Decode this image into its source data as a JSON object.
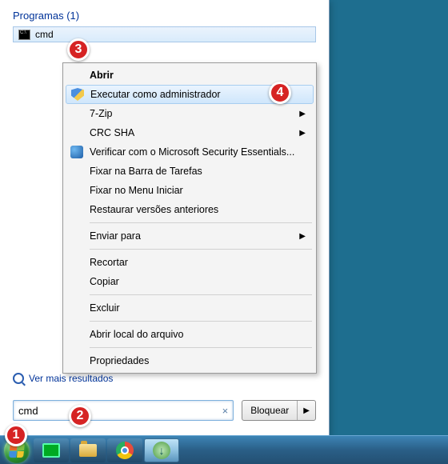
{
  "start_panel": {
    "section_header": "Programas (1)",
    "result_label": "cmd",
    "more_results": "Ver mais resultados",
    "search_value": "cmd",
    "lock_button": "Bloquear"
  },
  "context_menu": {
    "open": "Abrir",
    "run_as_admin": "Executar como administrador",
    "seven_zip": "7-Zip",
    "crc_sha": "CRC SHA",
    "verify_security": "Verificar com o Microsoft Security Essentials...",
    "pin_taskbar": "Fixar na Barra de Tarefas",
    "pin_start": "Fixar no Menu Iniciar",
    "restore_versions": "Restaurar versões anteriores",
    "send_to": "Enviar para",
    "cut": "Recortar",
    "copy": "Copiar",
    "delete": "Excluir",
    "open_location": "Abrir local do arquivo",
    "properties": "Propriedades"
  },
  "badges": {
    "b1": "1",
    "b2": "2",
    "b3": "3",
    "b4": "4"
  }
}
